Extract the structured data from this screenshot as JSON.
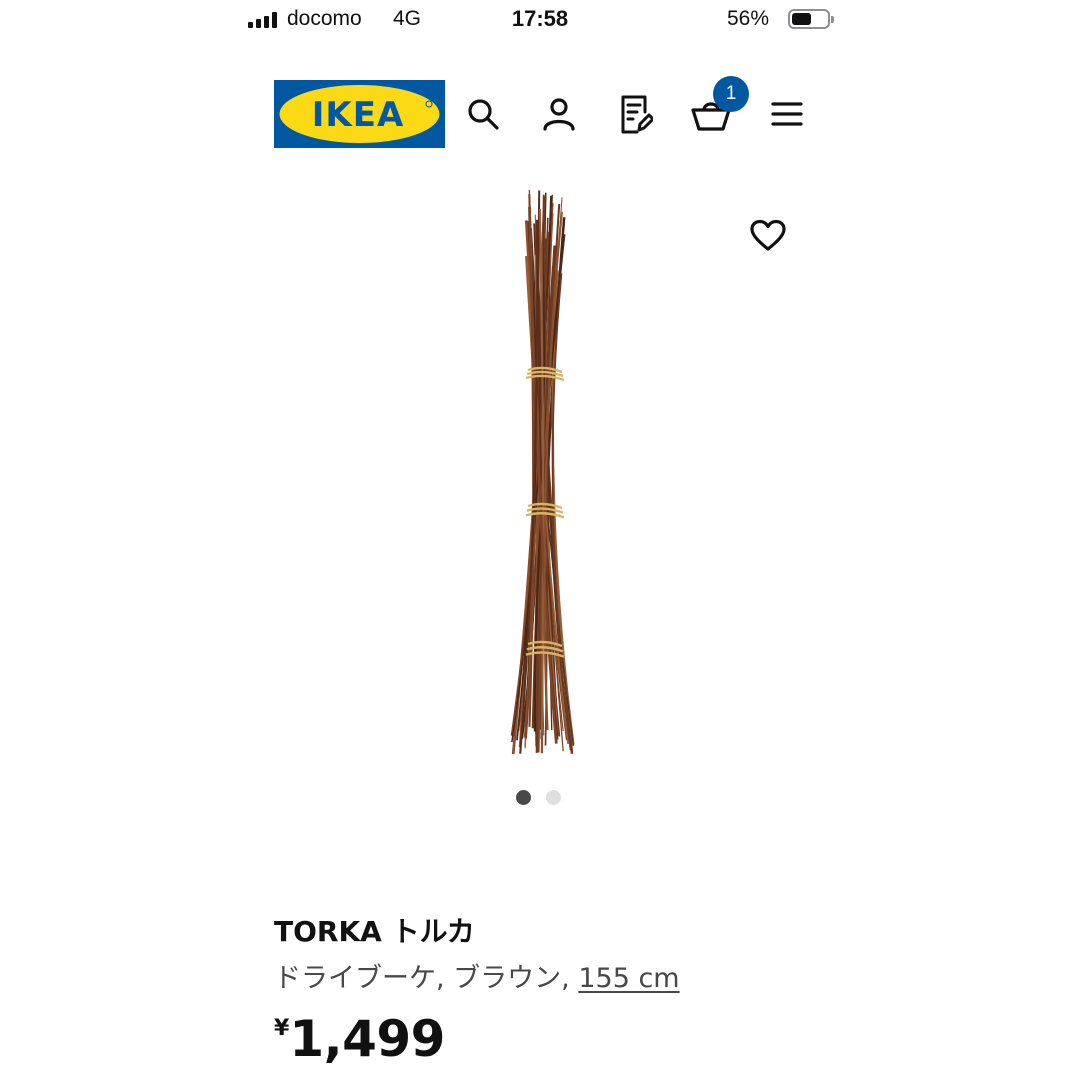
{
  "status_bar": {
    "carrier": "docomo",
    "network": "4G",
    "time": "17:58",
    "battery_percent_text": "56%",
    "battery_level": 0.56,
    "signal_bars": 4
  },
  "header": {
    "logo_text": "IKEA",
    "logo_colors": {
      "background": "#0058a3",
      "oval": "#fbd914",
      "text": "#0058a3"
    },
    "icons": [
      "search-icon",
      "account-icon",
      "shopping-list-icon",
      "cart-icon",
      "menu-icon"
    ],
    "cart_count": "1",
    "accent": "#0058a3"
  },
  "product": {
    "image": "bundle-of-dried-twigs-icon",
    "favorite_icon": "heart-icon",
    "carousel": {
      "count": 2,
      "active_index": 0
    },
    "name": "TORKA トルカ",
    "description_prefix": "ドライブーケ, ブラウン, ",
    "size": "155 cm",
    "currency": "¥",
    "price": "1,499"
  }
}
